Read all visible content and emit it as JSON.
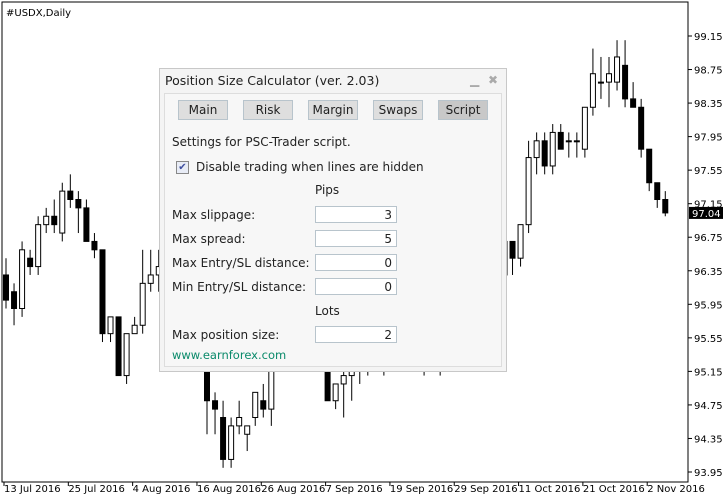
{
  "symbol_label": "#USDX,Daily",
  "chart_data": {
    "type": "candlestick",
    "title": "#USDX,Daily",
    "ylim": [
      93.95,
      99.15
    ],
    "y_ticks": [
      "99.15",
      "98.75",
      "98.35",
      "97.95",
      "97.55",
      "97.15",
      "96.75",
      "96.35",
      "95.95",
      "95.55",
      "95.15",
      "94.75",
      "94.35",
      "93.95"
    ],
    "x_ticks": [
      "13 Jul 2016",
      "25 Jul 2016",
      "4 Aug 2016",
      "16 Aug 2016",
      "26 Aug 2016",
      "7 Sep 2016",
      "19 Sep 2016",
      "29 Sep 2016",
      "11 Oct 2016",
      "21 Oct 2016",
      "2 Nov 2016"
    ],
    "current_price": "97.04",
    "colors": {
      "bull": "#ffffff",
      "bear": "#000000",
      "outline": "#000000"
    },
    "ohlc": [
      [
        96.3,
        96.5,
        95.9,
        96.0
      ],
      [
        96.1,
        96.2,
        95.7,
        95.9
      ],
      [
        95.9,
        96.7,
        95.8,
        96.6
      ],
      [
        96.5,
        96.6,
        96.3,
        96.4
      ],
      [
        96.4,
        97.0,
        96.3,
        96.9
      ],
      [
        96.9,
        97.1,
        96.8,
        97.0
      ],
      [
        97.0,
        97.2,
        96.8,
        96.9
      ],
      [
        96.8,
        97.4,
        96.7,
        97.3
      ],
      [
        97.3,
        97.5,
        97.1,
        97.2
      ],
      [
        97.2,
        97.3,
        96.8,
        97.1
      ],
      [
        97.1,
        97.2,
        96.7,
        96.7
      ],
      [
        96.7,
        96.8,
        96.5,
        96.6
      ],
      [
        96.6,
        96.6,
        95.5,
        95.6
      ],
      [
        95.6,
        95.8,
        95.5,
        95.8
      ],
      [
        95.8,
        95.8,
        95.1,
        95.1
      ],
      [
        95.1,
        95.6,
        95.0,
        95.6
      ],
      [
        95.6,
        95.8,
        95.6,
        95.7
      ],
      [
        95.7,
        96.6,
        95.6,
        96.2
      ],
      [
        96.2,
        96.6,
        96.1,
        96.3
      ],
      [
        96.3,
        96.6,
        96.1,
        96.4
      ],
      [
        96.4,
        96.6,
        96.0,
        96.3
      ],
      [
        96.3,
        96.4,
        95.7,
        95.8
      ],
      [
        95.8,
        96.0,
        95.6,
        95.9
      ],
      [
        95.9,
        96.0,
        95.7,
        95.8
      ],
      [
        95.8,
        95.8,
        95.5,
        95.6
      ],
      [
        95.6,
        95.6,
        94.4,
        94.8
      ],
      [
        94.8,
        94.9,
        94.4,
        94.7
      ],
      [
        94.6,
        94.8,
        94.0,
        94.1
      ],
      [
        94.1,
        94.6,
        94.0,
        94.5
      ],
      [
        94.5,
        94.8,
        94.4,
        94.6
      ],
      [
        94.4,
        94.5,
        94.2,
        94.5
      ],
      [
        94.6,
        94.9,
        94.5,
        94.9
      ],
      [
        94.8,
        95.0,
        94.6,
        94.7
      ],
      [
        94.7,
        95.8,
        94.5,
        95.5
      ],
      [
        95.6,
        95.9,
        95.5,
        95.7
      ],
      [
        95.5,
        96.3,
        95.5,
        96.2
      ],
      [
        96.1,
        96.4,
        96.0,
        96.0
      ],
      [
        96.0,
        96.2,
        95.6,
        95.7
      ],
      [
        95.7,
        96.0,
        95.4,
        95.9
      ],
      [
        95.9,
        96.0,
        95.7,
        95.8
      ],
      [
        95.8,
        95.9,
        94.8,
        94.8
      ],
      [
        94.8,
        95.0,
        94.7,
        95.0
      ],
      [
        95.0,
        95.2,
        94.6,
        95.1
      ],
      [
        95.1,
        95.5,
        94.8,
        95.4
      ],
      [
        95.4,
        95.5,
        95.0,
        95.2
      ],
      [
        95.2,
        95.7,
        95.1,
        95.6
      ],
      [
        95.6,
        95.8,
        95.3,
        95.3
      ],
      [
        95.3,
        95.4,
        95.1,
        95.3
      ],
      [
        95.3,
        96.2,
        95.2,
        96.1
      ],
      [
        96.1,
        96.2,
        95.8,
        95.8
      ],
      [
        95.8,
        96.1,
        95.7,
        96.0
      ],
      [
        96.0,
        96.1,
        95.5,
        95.5
      ],
      [
        95.5,
        95.7,
        95.1,
        95.4
      ],
      [
        95.4,
        95.6,
        95.3,
        95.5
      ],
      [
        95.5,
        95.6,
        95.1,
        95.3
      ],
      [
        95.3,
        95.6,
        95.2,
        95.5
      ],
      [
        95.5,
        95.7,
        95.3,
        95.5
      ],
      [
        95.4,
        95.9,
        95.4,
        95.6
      ],
      [
        95.6,
        95.7,
        95.4,
        95.5
      ],
      [
        95.5,
        95.8,
        95.4,
        95.7
      ],
      [
        95.7,
        96.2,
        95.6,
        96.2
      ],
      [
        96.2,
        96.4,
        96.0,
        96.2
      ],
      [
        96.3,
        96.8,
        96.1,
        96.7
      ],
      [
        96.7,
        96.7,
        96.3,
        96.5
      ],
      [
        96.5,
        96.9,
        96.4,
        96.9
      ],
      [
        96.9,
        97.9,
        96.8,
        97.7
      ],
      [
        97.7,
        98.0,
        97.5,
        97.9
      ],
      [
        97.9,
        98.0,
        97.5,
        97.6
      ],
      [
        97.6,
        98.1,
        97.5,
        98.0
      ],
      [
        98.0,
        98.1,
        97.8,
        97.8
      ],
      [
        97.9,
        98.0,
        97.7,
        97.9
      ],
      [
        97.9,
        98.0,
        97.7,
        97.9
      ],
      [
        97.8,
        98.3,
        97.7,
        98.3
      ],
      [
        98.3,
        99.0,
        98.2,
        98.7
      ],
      [
        98.6,
        98.9,
        98.4,
        98.6
      ],
      [
        98.6,
        98.9,
        98.3,
        98.7
      ],
      [
        98.6,
        99.1,
        98.5,
        98.9
      ],
      [
        98.8,
        99.1,
        98.3,
        98.4
      ],
      [
        98.4,
        98.6,
        98.3,
        98.3
      ],
      [
        98.3,
        98.4,
        97.7,
        97.8
      ],
      [
        97.8,
        97.8,
        97.3,
        97.4
      ],
      [
        97.4,
        97.4,
        97.1,
        97.2
      ],
      [
        97.2,
        97.3,
        97.0,
        97.04
      ]
    ]
  },
  "dialog": {
    "title": "Position Size Calculator (ver. 2.03)",
    "minimize_icon": "minimize-icon",
    "close_icon": "close-icon",
    "tabs": [
      {
        "label": "Main"
      },
      {
        "label": "Risk"
      },
      {
        "label": "Margin"
      },
      {
        "label": "Swaps"
      },
      {
        "label": "Script",
        "active": true
      }
    ],
    "heading": "Settings for PSC-Trader script.",
    "disable_trading": {
      "label": "Disable trading when lines are hidden",
      "checked": true
    },
    "pips_header": "Pips",
    "lots_header": "Lots",
    "fields": [
      {
        "label": "Max slippage:",
        "value": "3"
      },
      {
        "label": "Max spread:",
        "value": "5"
      },
      {
        "label": "Max Entry/SL distance:",
        "value": "0"
      },
      {
        "label": "Min Entry/SL distance:",
        "value": "0"
      },
      {
        "label": "Max position size:",
        "value": "2"
      }
    ],
    "link": "www.earnforex.com"
  }
}
